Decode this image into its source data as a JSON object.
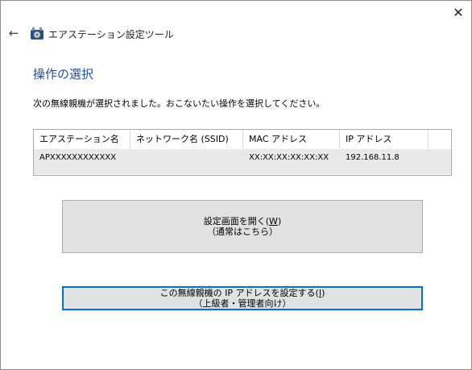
{
  "window": {
    "title": "エアステーション設定ツール",
    "close_glyph": "✕",
    "back_glyph": "←"
  },
  "page": {
    "heading": "操作の選択",
    "instruction": "次の無線親機が選択されました。おこないたい操作を選択してください。"
  },
  "table": {
    "columns": [
      "エアステーション名",
      "ネットワーク名 (SSID)",
      "MAC アドレス",
      "IP アドレス"
    ],
    "rows": [
      {
        "name": "APXXXXXXXXXXXX",
        "ssid": "",
        "mac": "XX:XX:XX:XX:XX:XX",
        "ip": "192.168.11.8"
      }
    ]
  },
  "buttons": {
    "open_settings": {
      "line1": "設定画面を開く(",
      "accel": "W",
      "line1_end": ")",
      "line2": "（通常はこちら）"
    },
    "set_ip": {
      "line1": "この無線親機の IP アドレスを設定する(",
      "accel": "I",
      "line1_end": ")",
      "line2": "（上級者・管理者向け）"
    }
  },
  "colors": {
    "heading": "#1e4d9c",
    "focus_border": "#0a6ccf",
    "row_bg": "#e9e9e9"
  },
  "icons": {
    "app": "airstation-tool-icon",
    "back": "back-arrow-icon",
    "close": "close-icon"
  }
}
